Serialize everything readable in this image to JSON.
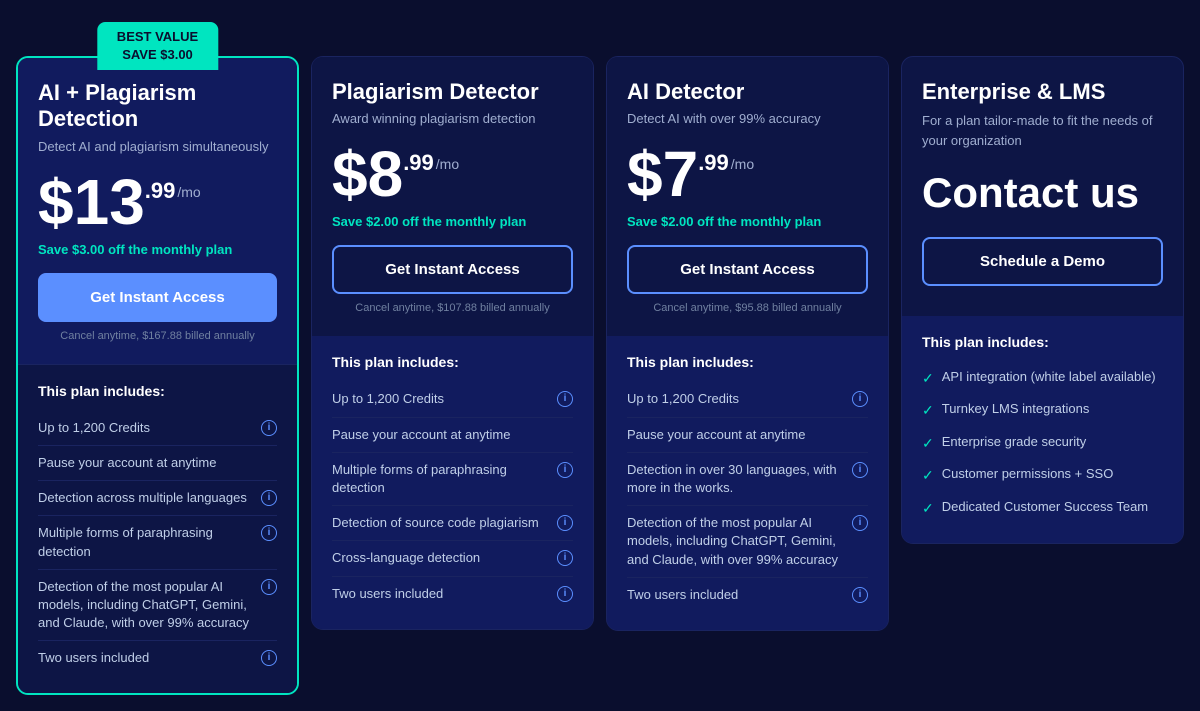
{
  "badge": {
    "line1": "BEST VALUE",
    "line2": "SAVE $3.00"
  },
  "plans": [
    {
      "id": "ai-plagiarism",
      "featured": true,
      "name": "AI + Plagiarism Detection",
      "subtitle": "Detect AI and plagiarism simultaneously",
      "price_main": "$13",
      "price_cents": ".99",
      "price_period": "/mo",
      "save_text": "Save $3.00 off the monthly plan",
      "btn_label": "Get Instant Access",
      "btn_filled": true,
      "cancel_text": "Cancel anytime, $167.88 billed annually",
      "includes_title": "This plan includes:",
      "features": [
        {
          "text": "Up to 1,200 Credits",
          "info": true
        },
        {
          "text": "Pause your account at anytime",
          "info": false
        },
        {
          "text": "Detection across multiple languages",
          "info": true
        },
        {
          "text": "Multiple forms of paraphrasing detection",
          "info": true
        },
        {
          "text": "Detection of the most popular AI models, including ChatGPT, Gemini, and Claude, with over 99% accuracy",
          "info": true
        },
        {
          "text": "Two users included",
          "info": true
        }
      ]
    },
    {
      "id": "plagiarism",
      "featured": false,
      "name": "Plagiarism Detector",
      "subtitle": "Award winning plagiarism detection",
      "price_main": "$8",
      "price_cents": ".99",
      "price_period": "/mo",
      "save_text": "Save $2.00 off the monthly plan",
      "btn_label": "Get Instant Access",
      "btn_filled": false,
      "cancel_text": "Cancel anytime, $107.88 billed annually",
      "includes_title": "This plan includes:",
      "features": [
        {
          "text": "Up to 1,200 Credits",
          "info": true
        },
        {
          "text": "Pause your account at anytime",
          "info": false
        },
        {
          "text": "Multiple forms of paraphrasing detection",
          "info": true
        },
        {
          "text": "Detection of source code plagiarism",
          "info": true
        },
        {
          "text": "Cross-language detection",
          "info": true
        },
        {
          "text": "Two users included",
          "info": true
        }
      ]
    },
    {
      "id": "ai-detector",
      "featured": false,
      "name": "AI Detector",
      "subtitle": "Detect AI with over 99% accuracy",
      "price_main": "$7",
      "price_cents": ".99",
      "price_period": "/mo",
      "save_text": "Save $2.00 off the monthly plan",
      "btn_label": "Get Instant Access",
      "btn_filled": false,
      "cancel_text": "Cancel anytime, $95.88 billed annually",
      "includes_title": "This plan includes:",
      "features": [
        {
          "text": "Up to 1,200 Credits",
          "info": true
        },
        {
          "text": "Pause your account at anytime",
          "info": false
        },
        {
          "text": "Detection in over 30 languages, with more in the works.",
          "info": true
        },
        {
          "text": "Detection of the most popular AI models, including ChatGPT, Gemini, and Claude, with over 99% accuracy",
          "info": true
        },
        {
          "text": "Two users included",
          "info": true
        }
      ]
    },
    {
      "id": "enterprise",
      "featured": false,
      "name": "Enterprise & LMS",
      "subtitle": "For a plan tailor-made to fit the needs of your organization",
      "contact_label": "Contact us",
      "btn_label": "Schedule a Demo",
      "includes_title": "This plan includes:",
      "check_features": [
        "API integration (white label available)",
        "Turnkey LMS integrations",
        "Enterprise grade security",
        "Customer permissions + SSO",
        "Dedicated Customer Success Team"
      ]
    }
  ]
}
